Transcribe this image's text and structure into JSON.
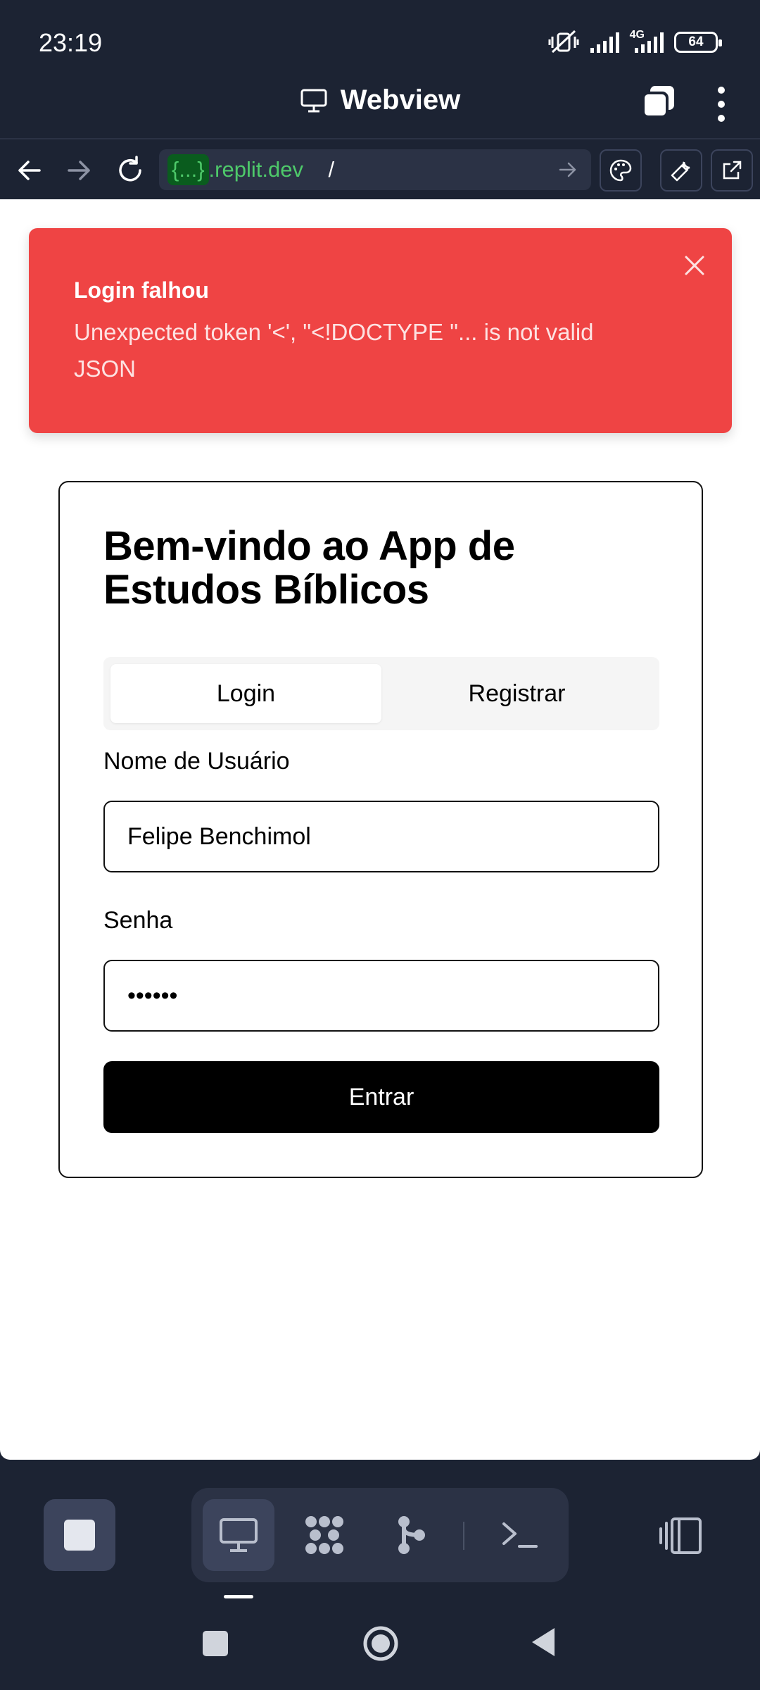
{
  "status_bar": {
    "time": "23:19",
    "network": "4G",
    "battery": "64"
  },
  "header": {
    "title": "Webview"
  },
  "url_bar": {
    "highlight": "{...}",
    "domain": ".replit.dev",
    "path": "/"
  },
  "toast": {
    "title": "Login falhou",
    "message": "Unexpected token '<', \"<!DOCTYPE \"... is not valid JSON"
  },
  "card": {
    "heading": "Bem-vindo ao App de Estudos Bíblicos",
    "tabs": [
      {
        "label": "Login",
        "active": true
      },
      {
        "label": "Registrar",
        "active": false
      }
    ],
    "username_label": "Nome de Usuário",
    "username_value": "Felipe Benchimol",
    "password_label": "Senha",
    "password_value": "••••••",
    "submit_label": "Entrar"
  },
  "colors": {
    "toast_bg": "#ef4444",
    "chrome_bg": "#1c2333",
    "url_green": "#4ec96a"
  }
}
